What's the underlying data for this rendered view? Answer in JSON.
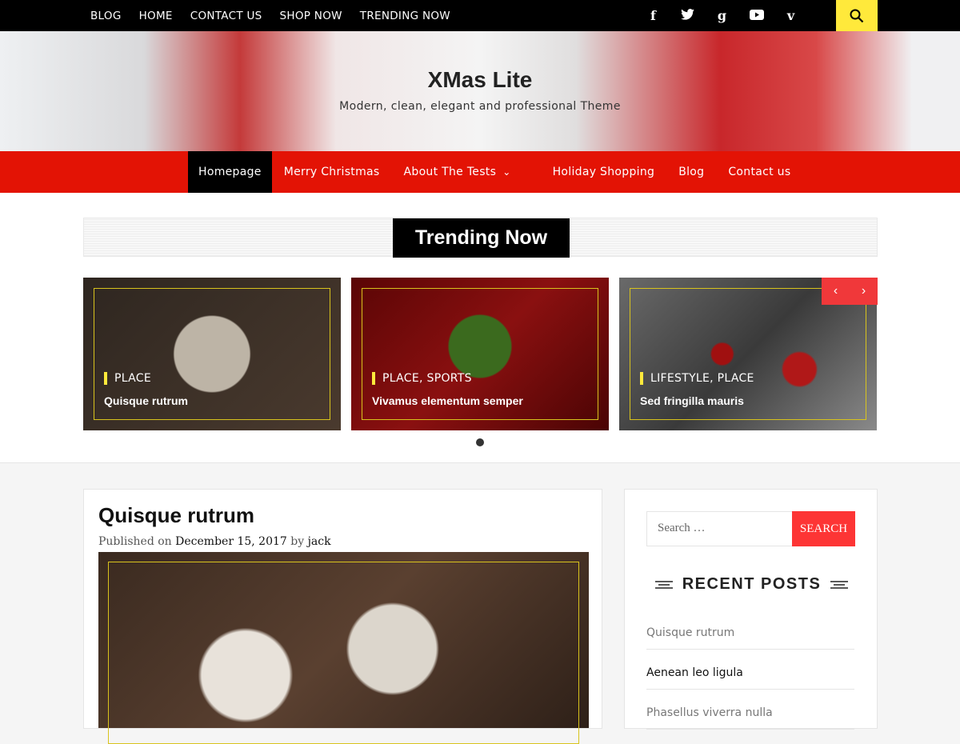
{
  "topbar": {
    "links": [
      "BLOG",
      "HOME",
      "CONTACT US",
      "SHOP NOW",
      "TRENDING NOW"
    ],
    "social": [
      "f",
      "g"
    ]
  },
  "header": {
    "title": "XMas Lite",
    "description": "Modern, clean, elegant and professional Theme"
  },
  "nav": {
    "items": [
      "Homepage",
      "Merry Christmas",
      "About The Tests",
      "Holiday Shopping",
      "Blog",
      "Contact us"
    ],
    "dropdown_arrow": "⌄"
  },
  "trending": {
    "title": "Trending Now",
    "cards": [
      {
        "category": "PLACE",
        "title": "Quisque rutrum"
      },
      {
        "category": "PLACE, SPORTS",
        "title": "Vivamus elementum semper"
      },
      {
        "category": "LIFESTYLE, PLACE",
        "title": "Sed fringilla mauris"
      }
    ],
    "prev": "‹",
    "next": "›"
  },
  "post": {
    "title": "Quisque rutrum",
    "published_prefix": "Published on",
    "date": "December 15, 2017",
    "by": "by",
    "author": "jack"
  },
  "sidebar": {
    "search_placeholder": "Search …",
    "search_button": "SEARCH",
    "recent_title": "RECENT POSTS",
    "recent": [
      "Quisque rutrum",
      "Aenean leo ligula",
      "Phasellus viverra nulla"
    ]
  }
}
